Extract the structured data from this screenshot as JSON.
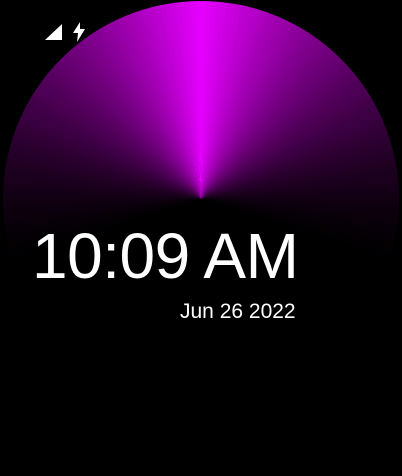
{
  "watchface": {
    "time": "10:09 AM",
    "date": "Jun 26 2022",
    "accent_color": "#e600ff",
    "background_color": "#000000"
  },
  "status_bar": {
    "icons": [
      "signal-icon",
      "charging-bolt-icon"
    ]
  }
}
